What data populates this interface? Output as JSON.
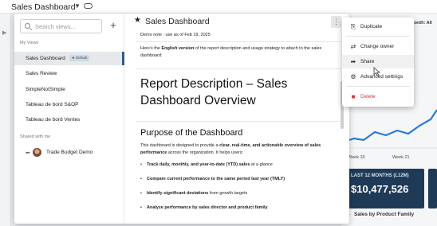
{
  "app": {
    "title": "Sales Dashboard",
    "bg": {
      "month_label": "Month: All",
      "card_label": "LAST 12 MONTHS (L12M)",
      "card_value": "$10,477,526",
      "family_label": "Sales by Product Family",
      "week_labels": [
        "Week 10",
        "Week 21"
      ]
    }
  },
  "sidebar": {
    "search_placeholder": "Search views...",
    "add_label": "+",
    "my_views_label": "My Views",
    "views": [
      {
        "label": "Sales Dashboard",
        "badge": "★ Default",
        "active": true
      },
      {
        "label": "Sales Review"
      },
      {
        "label": "SimpleNotSimple"
      },
      {
        "label": "Tableau de bord S&OP"
      },
      {
        "label": "Tableau de bord Ventes"
      }
    ],
    "shared_label": "Shared with me",
    "shared": [
      {
        "label": "Trade Budget Demo"
      }
    ]
  },
  "content": {
    "title": "Sales Dashboard",
    "kebab": "⋮",
    "demo_note": "Demo note : use as of Feb 19, 2025",
    "intro_pre": "Here's the ",
    "intro_bold": "English version",
    "intro_post": " of the report description and usage strategy to attach to the sales dashboard:",
    "h1": "Report Description – Sales Dashboard Overview",
    "h2": "Purpose of the Dashboard",
    "para_pre": "This dashboard is designed to provide a ",
    "para_bold": "clear, real-time, and actionable overview of sales performance",
    "para_post": " across the organization. It helps users:",
    "bullets": [
      {
        "bold": "Track daily, monthly, and year-to-date (YTD) sales",
        "rest": " at a glance"
      },
      {
        "bold": "Compare current performance to the same period last year (TMLY)",
        "rest": ""
      },
      {
        "bold": "Identify significant deviations",
        "rest": " from growth targets"
      },
      {
        "bold": "Analyze performance by sales director and product family",
        "rest": ""
      }
    ]
  },
  "menu": {
    "items": [
      {
        "label": "Duplicate",
        "icon": "⎘"
      },
      {
        "label": "Change owner",
        "icon": "⇄"
      },
      {
        "label": "Share",
        "icon": "➦"
      },
      {
        "label": "Advanced settings",
        "icon": "⚙"
      },
      {
        "label": "Delete",
        "icon": "■"
      }
    ]
  },
  "colors": {
    "accent": "#2f5b86",
    "danger": "#d9363e",
    "card": "#1f3a57",
    "chart_line": "#2b7bd6"
  }
}
